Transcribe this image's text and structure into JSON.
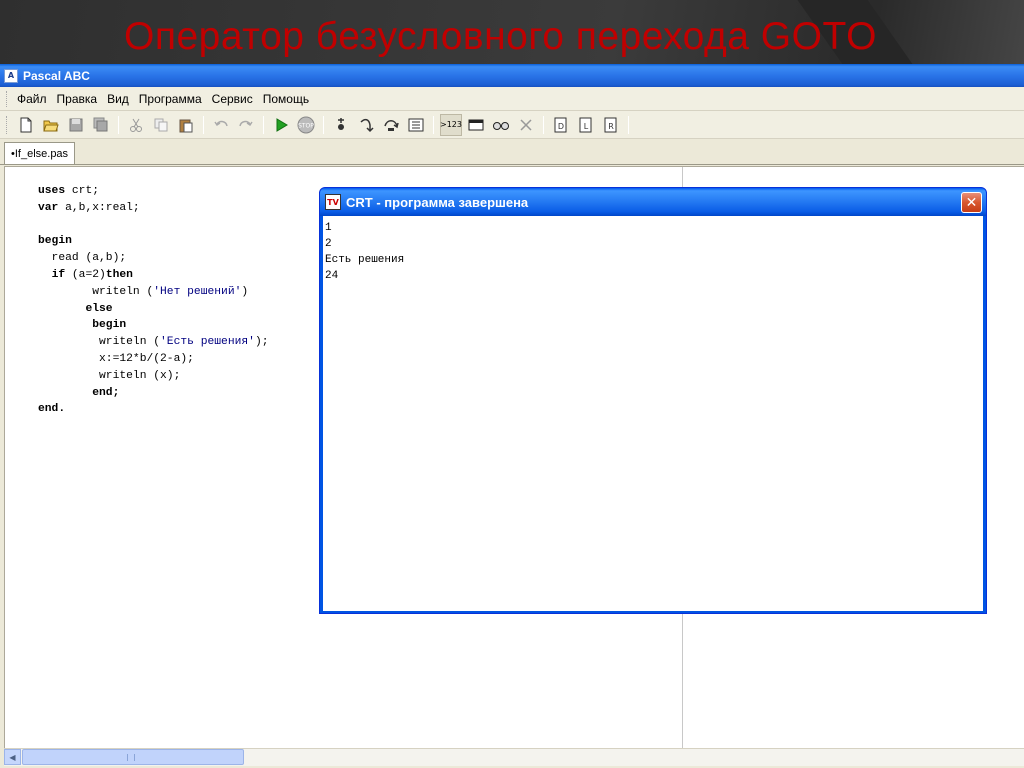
{
  "slide": {
    "title": "Оператор безусловного перехода GOTO"
  },
  "app": {
    "title": "Pascal ABC",
    "icon": "pascal-abc-icon",
    "menu": [
      "Файл",
      "Правка",
      "Вид",
      "Программа",
      "Сервис",
      "Помощь"
    ],
    "toolbar": {
      "output_label": ">123"
    },
    "active_tab": "•If_else.pas"
  },
  "code_lines": [
    [
      {
        "t": "uses",
        "c": "kw"
      },
      {
        "t": " crt;"
      }
    ],
    [
      {
        "t": "var",
        "c": "kw"
      },
      {
        "t": " a,b,x:real;"
      }
    ],
    [
      {
        "t": ""
      }
    ],
    [
      {
        "t": "begin",
        "c": "kw"
      }
    ],
    [
      {
        "t": "  read (a,b);"
      }
    ],
    [
      {
        "t": "  "
      },
      {
        "t": "if",
        "c": "kw"
      },
      {
        "t": " (a=2)"
      },
      {
        "t": "then",
        "c": "kw"
      }
    ],
    [
      {
        "t": "        writeln ("
      },
      {
        "t": "'Нет решений'",
        "c": "str"
      },
      {
        "t": ")"
      }
    ],
    [
      {
        "t": "       "
      },
      {
        "t": "else",
        "c": "kw"
      }
    ],
    [
      {
        "t": "       "
      },
      {
        "t": " begin",
        "c": "kw"
      }
    ],
    [
      {
        "t": "         writeln ("
      },
      {
        "t": "'Есть решения'",
        "c": "str"
      },
      {
        "t": ");"
      }
    ],
    [
      {
        "t": "         x:=12*b/(2-a);"
      }
    ],
    [
      {
        "t": "         writeln (x);"
      }
    ],
    [
      {
        "t": "        "
      },
      {
        "t": "end;",
        "c": "kw"
      }
    ],
    [
      {
        "t": "end.",
        "c": "kw"
      }
    ]
  ],
  "crt_window": {
    "title": "CRT - программа завершена",
    "output": [
      "1",
      "2",
      "Есть решения",
      "24"
    ]
  }
}
